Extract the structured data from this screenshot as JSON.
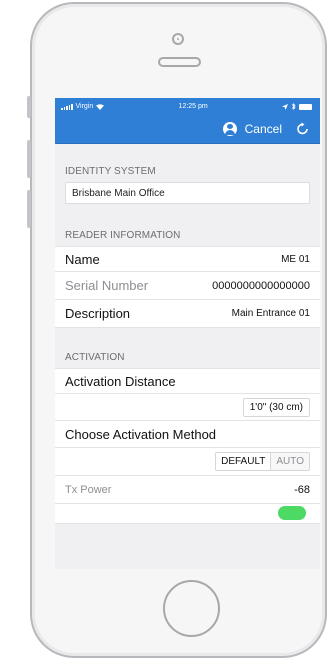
{
  "status_bar": {
    "carrier": "Virgin",
    "time": "12:25 pm"
  },
  "nav": {
    "cancel_label": "Cancel",
    "icons": [
      "profile-icon",
      "refresh-icon"
    ]
  },
  "identity_system": {
    "header": "IDENTITY SYSTEM",
    "value": "Brisbane Main Office"
  },
  "reader_information": {
    "header": "READER INFORMATION",
    "name_label": "Name",
    "name_value": "ME 01",
    "serial_label": "Serial Number",
    "serial_value": "0000000000000000",
    "description_label": "Description",
    "description_value": "Main Entrance  01"
  },
  "activation": {
    "header": "ACTIVATION",
    "distance_label": "Activation Distance",
    "distance_value": "1'0\" (30 cm)",
    "method_label": "Choose Activation Method",
    "method_options": [
      "DEFAULT",
      "AUTO"
    ],
    "method_selected": "DEFAULT",
    "tx_power_label": "Tx Power",
    "tx_power_value": "-68"
  },
  "colors": {
    "accent": "#2f7fd6",
    "toggle_on": "#4cd964"
  }
}
